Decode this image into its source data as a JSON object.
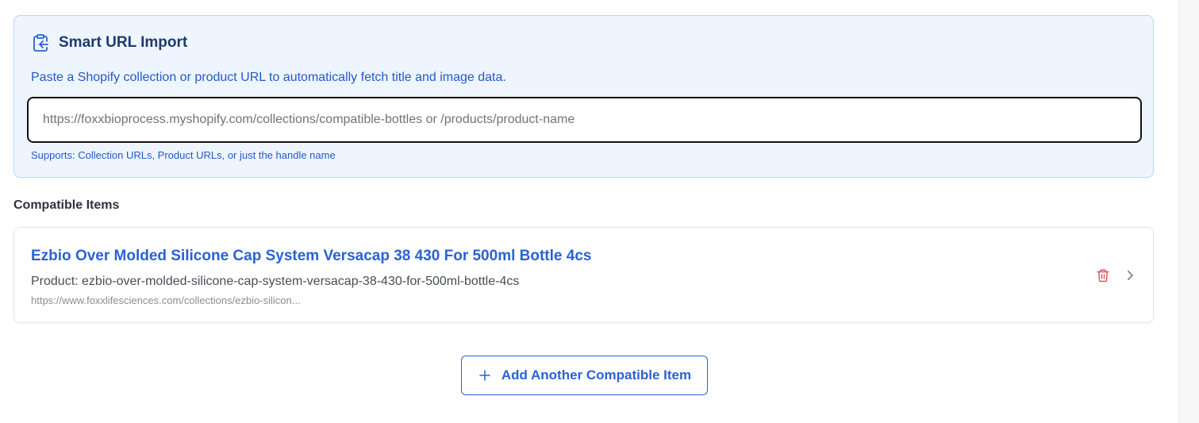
{
  "import_panel": {
    "title": "Smart URL Import",
    "icon": "clipboard-import-icon",
    "description": "Paste a Shopify collection or product URL to automatically fetch title and image data.",
    "input_placeholder": "https://foxxbioprocess.myshopify.com/collections/compatible-bottles or /products/product-name",
    "input_value": "",
    "hint": "Supports: Collection URLs, Product URLs, or just the handle name"
  },
  "compatible_items": {
    "label": "Compatible Items",
    "items": [
      {
        "title": "Ezbio Over Molded Silicone Cap System Versacap 38 430 For 500ml Bottle 4cs",
        "product": "Product: ezbio-over-molded-silicone-cap-system-versacap-38-430-for-500ml-bottle-4cs",
        "url": "https://www.foxxlifesciences.com/collections/ezbio-silicon..."
      }
    ]
  },
  "add_button": {
    "label": "Add Another Compatible Item",
    "icon": "plus-icon"
  },
  "colors": {
    "accent": "#2a62d4",
    "panel_bg": "#eef5ff",
    "panel_border": "#bcd3f5",
    "delete": "#e05252"
  }
}
